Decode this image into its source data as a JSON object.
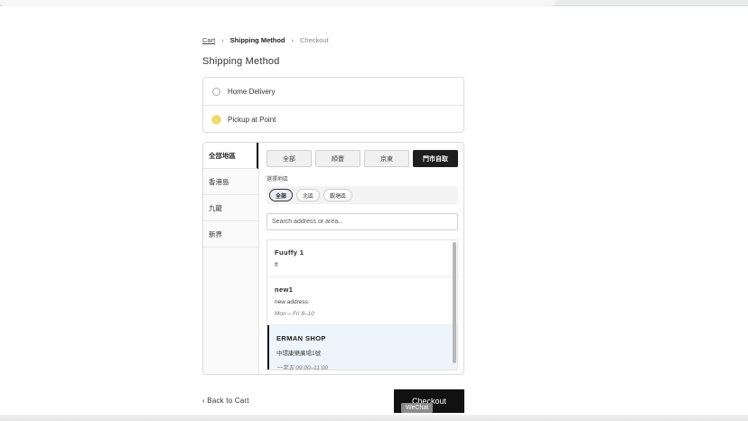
{
  "breadcrumb": {
    "cart": "Cart",
    "separator_1": "›",
    "current": "Shipping Method",
    "separator_2": "›",
    "next": "Checkout"
  },
  "page_title": "Shipping Method",
  "shipping_methods": [
    {
      "label": "Home Delivery",
      "selected": false
    },
    {
      "label": "Pickup at Point",
      "selected": true
    }
  ],
  "regions": [
    {
      "label": "全部地區",
      "active": true
    },
    {
      "label": "香港島",
      "active": false
    },
    {
      "label": "九龍",
      "active": false
    },
    {
      "label": "新界",
      "active": false
    }
  ],
  "filter_tabs": [
    {
      "label": "全部",
      "active": false
    },
    {
      "label": "順豐",
      "active": false
    },
    {
      "label": "京東",
      "active": false
    },
    {
      "label": "門市自取",
      "active": true
    }
  ],
  "area_label": "選擇地區",
  "area_chips": [
    {
      "label": "全部",
      "active": true
    },
    {
      "label": "北區",
      "active": false
    },
    {
      "label": "觀塘區",
      "active": false
    }
  ],
  "search": {
    "placeholder": "Search address or area...",
    "value": ""
  },
  "pickup_points": [
    {
      "name": "Fuuffy 1",
      "address": "ff",
      "hours": ""
    },
    {
      "name": "new1",
      "address": "new address",
      "hours": "Mon – Fri 8–10"
    },
    {
      "name": "ERMAN SHOP",
      "address": "中環康樂廣場1號",
      "hours": "一至五 09:00–11:00"
    }
  ],
  "footer": {
    "back_label": "‹ Back to Cart",
    "checkout_label": "Checkout"
  },
  "tooltip": "WeChat",
  "colors": {
    "accent": "#111111",
    "radio_selected": "#f3db6a",
    "selected_item_bg": "#eef4fb"
  }
}
